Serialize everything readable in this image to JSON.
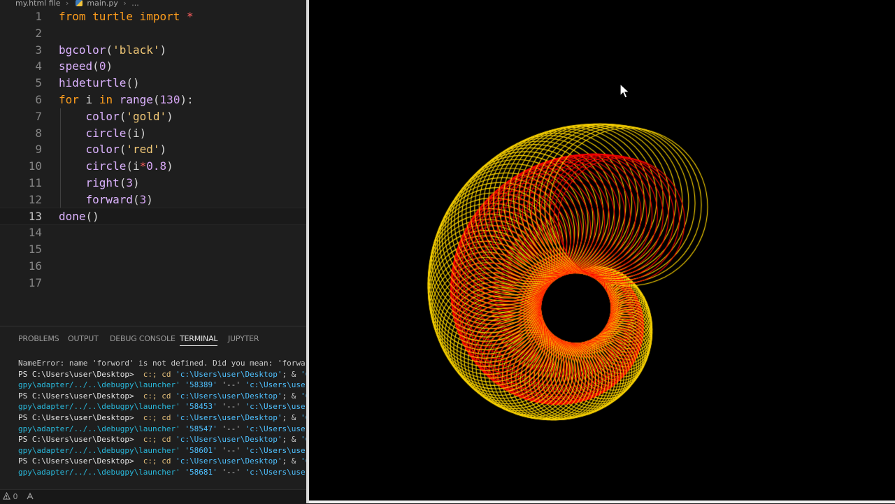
{
  "breadcrumb": {
    "folder": "my.html file",
    "file": "main.py",
    "tail": "..."
  },
  "code": [
    {
      "n": "1",
      "tokens": [
        [
          "kw2",
          "from"
        ],
        [
          "pl",
          " "
        ],
        [
          "mod",
          "turtle"
        ],
        [
          "pl",
          " "
        ],
        [
          "kw2",
          "import"
        ],
        [
          "pl",
          " "
        ],
        [
          "op",
          "*"
        ]
      ]
    },
    {
      "n": "2",
      "tokens": []
    },
    {
      "n": "3",
      "tokens": [
        [
          "fn",
          "bgcolor"
        ],
        [
          "pl",
          "("
        ],
        [
          "str",
          "'black'"
        ],
        [
          "pl",
          ")"
        ]
      ]
    },
    {
      "n": "4",
      "tokens": [
        [
          "fn",
          "speed"
        ],
        [
          "pl",
          "("
        ],
        [
          "num",
          "0"
        ],
        [
          "pl",
          ")"
        ]
      ]
    },
    {
      "n": "5",
      "tokens": [
        [
          "fn",
          "hideturtle"
        ],
        [
          "pl",
          "()"
        ]
      ]
    },
    {
      "n": "6",
      "tokens": [
        [
          "kw2",
          "for"
        ],
        [
          "pl",
          " "
        ],
        [
          "var",
          "i"
        ],
        [
          "pl",
          " "
        ],
        [
          "kw2",
          "in"
        ],
        [
          "pl",
          " "
        ],
        [
          "fn",
          "range"
        ],
        [
          "pl",
          "("
        ],
        [
          "num",
          "130"
        ],
        [
          "pl",
          "):"
        ]
      ]
    },
    {
      "n": "7",
      "tokens": [
        [
          "pl",
          "    "
        ],
        [
          "fn",
          "color"
        ],
        [
          "pl",
          "("
        ],
        [
          "str",
          "'gold'"
        ],
        [
          "pl",
          ")"
        ]
      ]
    },
    {
      "n": "8",
      "tokens": [
        [
          "pl",
          "    "
        ],
        [
          "fn",
          "circle"
        ],
        [
          "pl",
          "("
        ],
        [
          "var",
          "i"
        ],
        [
          "pl",
          ")"
        ]
      ]
    },
    {
      "n": "9",
      "tokens": [
        [
          "pl",
          "    "
        ],
        [
          "fn",
          "color"
        ],
        [
          "pl",
          "("
        ],
        [
          "str",
          "'red'"
        ],
        [
          "pl",
          ")"
        ]
      ]
    },
    {
      "n": "10",
      "tokens": [
        [
          "pl",
          "    "
        ],
        [
          "fn",
          "circle"
        ],
        [
          "pl",
          "("
        ],
        [
          "var",
          "i"
        ],
        [
          "op",
          "*"
        ],
        [
          "num",
          "0.8"
        ],
        [
          "pl",
          ")"
        ]
      ]
    },
    {
      "n": "11",
      "tokens": [
        [
          "pl",
          "    "
        ],
        [
          "fn",
          "right"
        ],
        [
          "pl",
          "("
        ],
        [
          "num",
          "3"
        ],
        [
          "pl",
          ")"
        ]
      ]
    },
    {
      "n": "12",
      "tokens": [
        [
          "pl",
          "    "
        ],
        [
          "fn",
          "forward"
        ],
        [
          "pl",
          "("
        ],
        [
          "num",
          "3"
        ],
        [
          "pl",
          ")"
        ]
      ]
    },
    {
      "n": "13",
      "tokens": [
        [
          "fn",
          "done"
        ],
        [
          "pl",
          "()"
        ]
      ],
      "active": true
    },
    {
      "n": "14",
      "tokens": []
    },
    {
      "n": "15",
      "tokens": []
    },
    {
      "n": "16",
      "tokens": []
    },
    {
      "n": "17",
      "tokens": []
    }
  ],
  "panel": {
    "tabs": [
      "PROBLEMS",
      "OUTPUT",
      "DEBUG CONSOLE",
      "TERMINAL",
      "JUPYTER"
    ],
    "active_tab": "TERMINAL"
  },
  "terminal_lines": [
    [
      [
        "plain",
        "NameError: name 'forword' is not defined. Did you mean: 'forward'?"
      ]
    ],
    [
      [
        "prompt",
        "PS C:\\Users\\user\\Desktop> "
      ],
      [
        "cmd",
        " c:; cd "
      ],
      [
        "str",
        "'c:\\Users\\user\\Desktop'"
      ],
      [
        "plain",
        "; & "
      ],
      [
        "str",
        "'C:"
      ]
    ],
    [
      [
        "cont",
        "gpy\\adapter/../..\\debugpy\\launcher' "
      ],
      [
        "str",
        "'58389'"
      ],
      [
        "plain",
        " '--' "
      ],
      [
        "str",
        "'c:\\Users\\user\\"
      ]
    ],
    [
      [
        "prompt",
        "PS C:\\Users\\user\\Desktop> "
      ],
      [
        "cmd",
        " c:; cd "
      ],
      [
        "str",
        "'c:\\Users\\user\\Desktop'"
      ],
      [
        "plain",
        "; & "
      ],
      [
        "str",
        "'C:"
      ]
    ],
    [
      [
        "cont",
        "gpy\\adapter/../..\\debugpy\\launcher' "
      ],
      [
        "str",
        "'58453'"
      ],
      [
        "plain",
        " '--' "
      ],
      [
        "str",
        "'c:\\Users\\user\\"
      ]
    ],
    [
      [
        "prompt",
        "PS C:\\Users\\user\\Desktop> "
      ],
      [
        "cmd",
        " c:; cd "
      ],
      [
        "str",
        "'c:\\Users\\user\\Desktop'"
      ],
      [
        "plain",
        "; & "
      ],
      [
        "str",
        "'C:"
      ]
    ],
    [
      [
        "cont",
        "gpy\\adapter/../..\\debugpy\\launcher' "
      ],
      [
        "str",
        "'58547'"
      ],
      [
        "plain",
        " '--' "
      ],
      [
        "str",
        "'c:\\Users\\user\\"
      ]
    ],
    [
      [
        "prompt",
        "PS C:\\Users\\user\\Desktop> "
      ],
      [
        "cmd",
        " c:; cd "
      ],
      [
        "str",
        "'c:\\Users\\user\\Desktop'"
      ],
      [
        "plain",
        "; & "
      ],
      [
        "str",
        "'C:"
      ]
    ],
    [
      [
        "cont",
        "gpy\\adapter/../..\\debugpy\\launcher' "
      ],
      [
        "str",
        "'58601'"
      ],
      [
        "plain",
        " '--' "
      ],
      [
        "str",
        "'c:\\Users\\user\\"
      ]
    ],
    [
      [
        "prompt",
        "PS C:\\Users\\user\\Desktop> "
      ],
      [
        "cmd",
        " c:; cd "
      ],
      [
        "str",
        "'c:\\Users\\user\\Desktop'"
      ],
      [
        "plain",
        "; & "
      ],
      [
        "str",
        "'C:"
      ]
    ],
    [
      [
        "cont",
        "gpy\\adapter/../..\\debugpy\\launcher' "
      ],
      [
        "str",
        "'58681'"
      ],
      [
        "plain",
        " '--' "
      ],
      [
        "str",
        "'c:\\Users\\user\\"
      ]
    ]
  ],
  "statusbar": {
    "warnings": "0",
    "warning_icon": "warning-icon",
    "port_icon": "remote-icon"
  },
  "turtle": {
    "background": "#000000",
    "outer_color": "#ffd700",
    "inner_color": "#ff0000",
    "iterations": 130,
    "inner_scale": 0.8,
    "turn_degrees": 3,
    "step": 3
  },
  "colors": {
    "editor_bg": "#1e1e1e",
    "divider": "#d9d9d9"
  }
}
